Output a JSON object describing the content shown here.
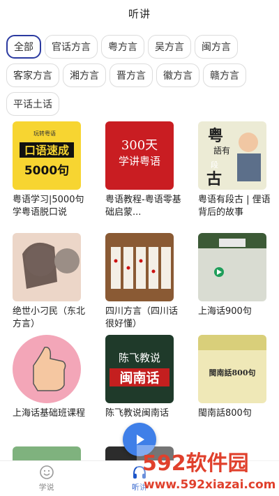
{
  "header": {
    "title": "听讲"
  },
  "tags": [
    {
      "label": "全部",
      "active": true
    },
    {
      "label": "官话方言",
      "active": false
    },
    {
      "label": "粤方言",
      "active": false
    },
    {
      "label": "吴方言",
      "active": false
    },
    {
      "label": "闽方言",
      "active": false
    },
    {
      "label": "客家方言",
      "active": false
    },
    {
      "label": "湘方言",
      "active": false
    },
    {
      "label": "晋方言",
      "active": false
    },
    {
      "label": "徽方言",
      "active": false
    },
    {
      "label": "赣方言",
      "active": false
    },
    {
      "label": "平话土话",
      "active": false
    }
  ],
  "courses": [
    {
      "caption": "粤语学习|5000句学粤语脱口说",
      "cover": {
        "line1": "玩转粤语",
        "line2": "口语速成",
        "line3": "5000句"
      }
    },
    {
      "caption": "粤语教程-粤语零基础启蒙...",
      "cover": {
        "line1": "300天",
        "line2": "学讲粤语"
      }
    },
    {
      "caption": "粤语有段古 | 俚语背后的故事",
      "cover": {
        "line1": "粤",
        "line2": "語有",
        "line3": "段",
        "line4": "古"
      }
    },
    {
      "caption": "绝世小刁民（东北方言）",
      "cover": {}
    },
    {
      "caption": "四川方言（四川话很好懂）",
      "cover": {}
    },
    {
      "caption": "上海话900句",
      "cover": {}
    },
    {
      "caption": "上海话基础班课程",
      "cover": {}
    },
    {
      "caption": "陈飞教说闽南话",
      "cover": {
        "line1": "陈飞教说",
        "line2": "闽南话"
      }
    },
    {
      "caption": "閩南話800句",
      "cover": {
        "line1": "閩南話800句"
      }
    }
  ],
  "bottom_nav": [
    {
      "label": "学说",
      "icon": "smiley-icon",
      "active": false
    },
    {
      "label": "听讲",
      "icon": "headphones-icon",
      "active": true
    },
    {
      "label": "",
      "icon": "",
      "active": false
    }
  ],
  "watermark": {
    "brand": "592软件园",
    "url": "www.592xiazai.com"
  },
  "colors": {
    "accent": "#2b3aa0",
    "tab_active": "#1d55c8",
    "play": "#3f7fe8"
  }
}
